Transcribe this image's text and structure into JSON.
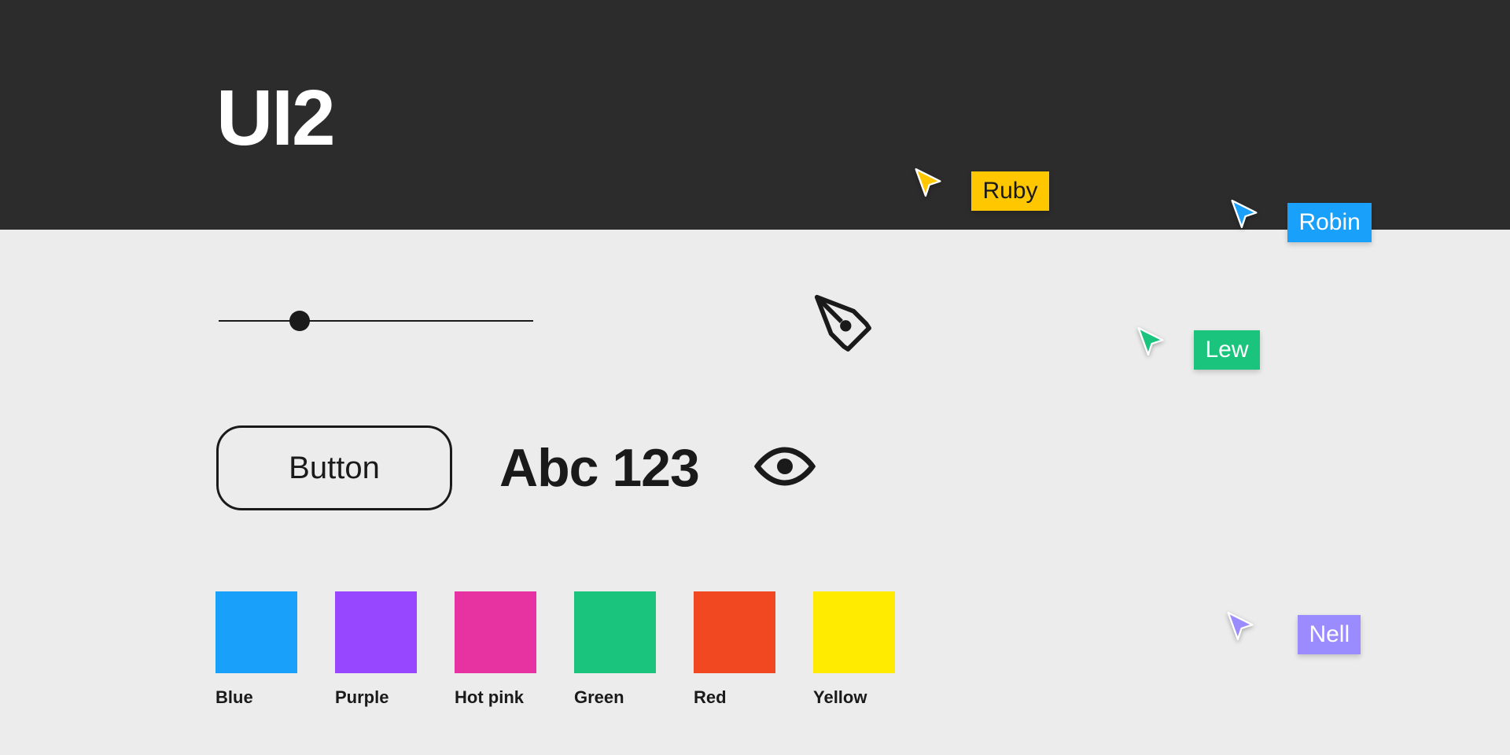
{
  "header": {
    "title": "UI2"
  },
  "controls": {
    "button_label": "Button",
    "text_sample": "Abc 123"
  },
  "swatches": [
    {
      "label": "Blue",
      "color": "#18a0fb"
    },
    {
      "label": "Purple",
      "color": "#9747ff"
    },
    {
      "label": "Hot pink",
      "color": "#e732a1"
    },
    {
      "label": "Green",
      "color": "#1bc47d"
    },
    {
      "label": "Red",
      "color": "#f24822"
    },
    {
      "label": "Yellow",
      "color": "#ffeb00"
    }
  ],
  "cursors": {
    "ruby": {
      "name": "Ruby",
      "color": "#ffc700",
      "text": "dark"
    },
    "robin": {
      "name": "Robin",
      "color": "#18a0fb",
      "text": "light"
    },
    "lew": {
      "name": "Lew",
      "color": "#1bc47d",
      "text": "light"
    },
    "nell": {
      "name": "Nell",
      "color": "#9a8cff",
      "text": "light"
    }
  }
}
